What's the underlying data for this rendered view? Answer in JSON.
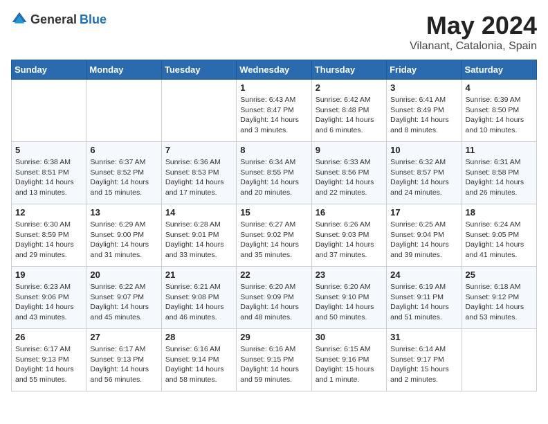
{
  "header": {
    "logo_general": "General",
    "logo_blue": "Blue",
    "month_year": "May 2024",
    "location": "Vilanant, Catalonia, Spain"
  },
  "days_of_week": [
    "Sunday",
    "Monday",
    "Tuesday",
    "Wednesday",
    "Thursday",
    "Friday",
    "Saturday"
  ],
  "weeks": [
    [
      {
        "day": "",
        "sunrise": "",
        "sunset": "",
        "daylight": ""
      },
      {
        "day": "",
        "sunrise": "",
        "sunset": "",
        "daylight": ""
      },
      {
        "day": "",
        "sunrise": "",
        "sunset": "",
        "daylight": ""
      },
      {
        "day": "1",
        "sunrise": "Sunrise: 6:43 AM",
        "sunset": "Sunset: 8:47 PM",
        "daylight": "Daylight: 14 hours and 3 minutes."
      },
      {
        "day": "2",
        "sunrise": "Sunrise: 6:42 AM",
        "sunset": "Sunset: 8:48 PM",
        "daylight": "Daylight: 14 hours and 6 minutes."
      },
      {
        "day": "3",
        "sunrise": "Sunrise: 6:41 AM",
        "sunset": "Sunset: 8:49 PM",
        "daylight": "Daylight: 14 hours and 8 minutes."
      },
      {
        "day": "4",
        "sunrise": "Sunrise: 6:39 AM",
        "sunset": "Sunset: 8:50 PM",
        "daylight": "Daylight: 14 hours and 10 minutes."
      }
    ],
    [
      {
        "day": "5",
        "sunrise": "Sunrise: 6:38 AM",
        "sunset": "Sunset: 8:51 PM",
        "daylight": "Daylight: 14 hours and 13 minutes."
      },
      {
        "day": "6",
        "sunrise": "Sunrise: 6:37 AM",
        "sunset": "Sunset: 8:52 PM",
        "daylight": "Daylight: 14 hours and 15 minutes."
      },
      {
        "day": "7",
        "sunrise": "Sunrise: 6:36 AM",
        "sunset": "Sunset: 8:53 PM",
        "daylight": "Daylight: 14 hours and 17 minutes."
      },
      {
        "day": "8",
        "sunrise": "Sunrise: 6:34 AM",
        "sunset": "Sunset: 8:55 PM",
        "daylight": "Daylight: 14 hours and 20 minutes."
      },
      {
        "day": "9",
        "sunrise": "Sunrise: 6:33 AM",
        "sunset": "Sunset: 8:56 PM",
        "daylight": "Daylight: 14 hours and 22 minutes."
      },
      {
        "day": "10",
        "sunrise": "Sunrise: 6:32 AM",
        "sunset": "Sunset: 8:57 PM",
        "daylight": "Daylight: 14 hours and 24 minutes."
      },
      {
        "day": "11",
        "sunrise": "Sunrise: 6:31 AM",
        "sunset": "Sunset: 8:58 PM",
        "daylight": "Daylight: 14 hours and 26 minutes."
      }
    ],
    [
      {
        "day": "12",
        "sunrise": "Sunrise: 6:30 AM",
        "sunset": "Sunset: 8:59 PM",
        "daylight": "Daylight: 14 hours and 29 minutes."
      },
      {
        "day": "13",
        "sunrise": "Sunrise: 6:29 AM",
        "sunset": "Sunset: 9:00 PM",
        "daylight": "Daylight: 14 hours and 31 minutes."
      },
      {
        "day": "14",
        "sunrise": "Sunrise: 6:28 AM",
        "sunset": "Sunset: 9:01 PM",
        "daylight": "Daylight: 14 hours and 33 minutes."
      },
      {
        "day": "15",
        "sunrise": "Sunrise: 6:27 AM",
        "sunset": "Sunset: 9:02 PM",
        "daylight": "Daylight: 14 hours and 35 minutes."
      },
      {
        "day": "16",
        "sunrise": "Sunrise: 6:26 AM",
        "sunset": "Sunset: 9:03 PM",
        "daylight": "Daylight: 14 hours and 37 minutes."
      },
      {
        "day": "17",
        "sunrise": "Sunrise: 6:25 AM",
        "sunset": "Sunset: 9:04 PM",
        "daylight": "Daylight: 14 hours and 39 minutes."
      },
      {
        "day": "18",
        "sunrise": "Sunrise: 6:24 AM",
        "sunset": "Sunset: 9:05 PM",
        "daylight": "Daylight: 14 hours and 41 minutes."
      }
    ],
    [
      {
        "day": "19",
        "sunrise": "Sunrise: 6:23 AM",
        "sunset": "Sunset: 9:06 PM",
        "daylight": "Daylight: 14 hours and 43 minutes."
      },
      {
        "day": "20",
        "sunrise": "Sunrise: 6:22 AM",
        "sunset": "Sunset: 9:07 PM",
        "daylight": "Daylight: 14 hours and 45 minutes."
      },
      {
        "day": "21",
        "sunrise": "Sunrise: 6:21 AM",
        "sunset": "Sunset: 9:08 PM",
        "daylight": "Daylight: 14 hours and 46 minutes."
      },
      {
        "day": "22",
        "sunrise": "Sunrise: 6:20 AM",
        "sunset": "Sunset: 9:09 PM",
        "daylight": "Daylight: 14 hours and 48 minutes."
      },
      {
        "day": "23",
        "sunrise": "Sunrise: 6:20 AM",
        "sunset": "Sunset: 9:10 PM",
        "daylight": "Daylight: 14 hours and 50 minutes."
      },
      {
        "day": "24",
        "sunrise": "Sunrise: 6:19 AM",
        "sunset": "Sunset: 9:11 PM",
        "daylight": "Daylight: 14 hours and 51 minutes."
      },
      {
        "day": "25",
        "sunrise": "Sunrise: 6:18 AM",
        "sunset": "Sunset: 9:12 PM",
        "daylight": "Daylight: 14 hours and 53 minutes."
      }
    ],
    [
      {
        "day": "26",
        "sunrise": "Sunrise: 6:17 AM",
        "sunset": "Sunset: 9:13 PM",
        "daylight": "Daylight: 14 hours and 55 minutes."
      },
      {
        "day": "27",
        "sunrise": "Sunrise: 6:17 AM",
        "sunset": "Sunset: 9:13 PM",
        "daylight": "Daylight: 14 hours and 56 minutes."
      },
      {
        "day": "28",
        "sunrise": "Sunrise: 6:16 AM",
        "sunset": "Sunset: 9:14 PM",
        "daylight": "Daylight: 14 hours and 58 minutes."
      },
      {
        "day": "29",
        "sunrise": "Sunrise: 6:16 AM",
        "sunset": "Sunset: 9:15 PM",
        "daylight": "Daylight: 14 hours and 59 minutes."
      },
      {
        "day": "30",
        "sunrise": "Sunrise: 6:15 AM",
        "sunset": "Sunset: 9:16 PM",
        "daylight": "Daylight: 15 hours and 1 minute."
      },
      {
        "day": "31",
        "sunrise": "Sunrise: 6:14 AM",
        "sunset": "Sunset: 9:17 PM",
        "daylight": "Daylight: 15 hours and 2 minutes."
      },
      {
        "day": "",
        "sunrise": "",
        "sunset": "",
        "daylight": ""
      }
    ]
  ]
}
